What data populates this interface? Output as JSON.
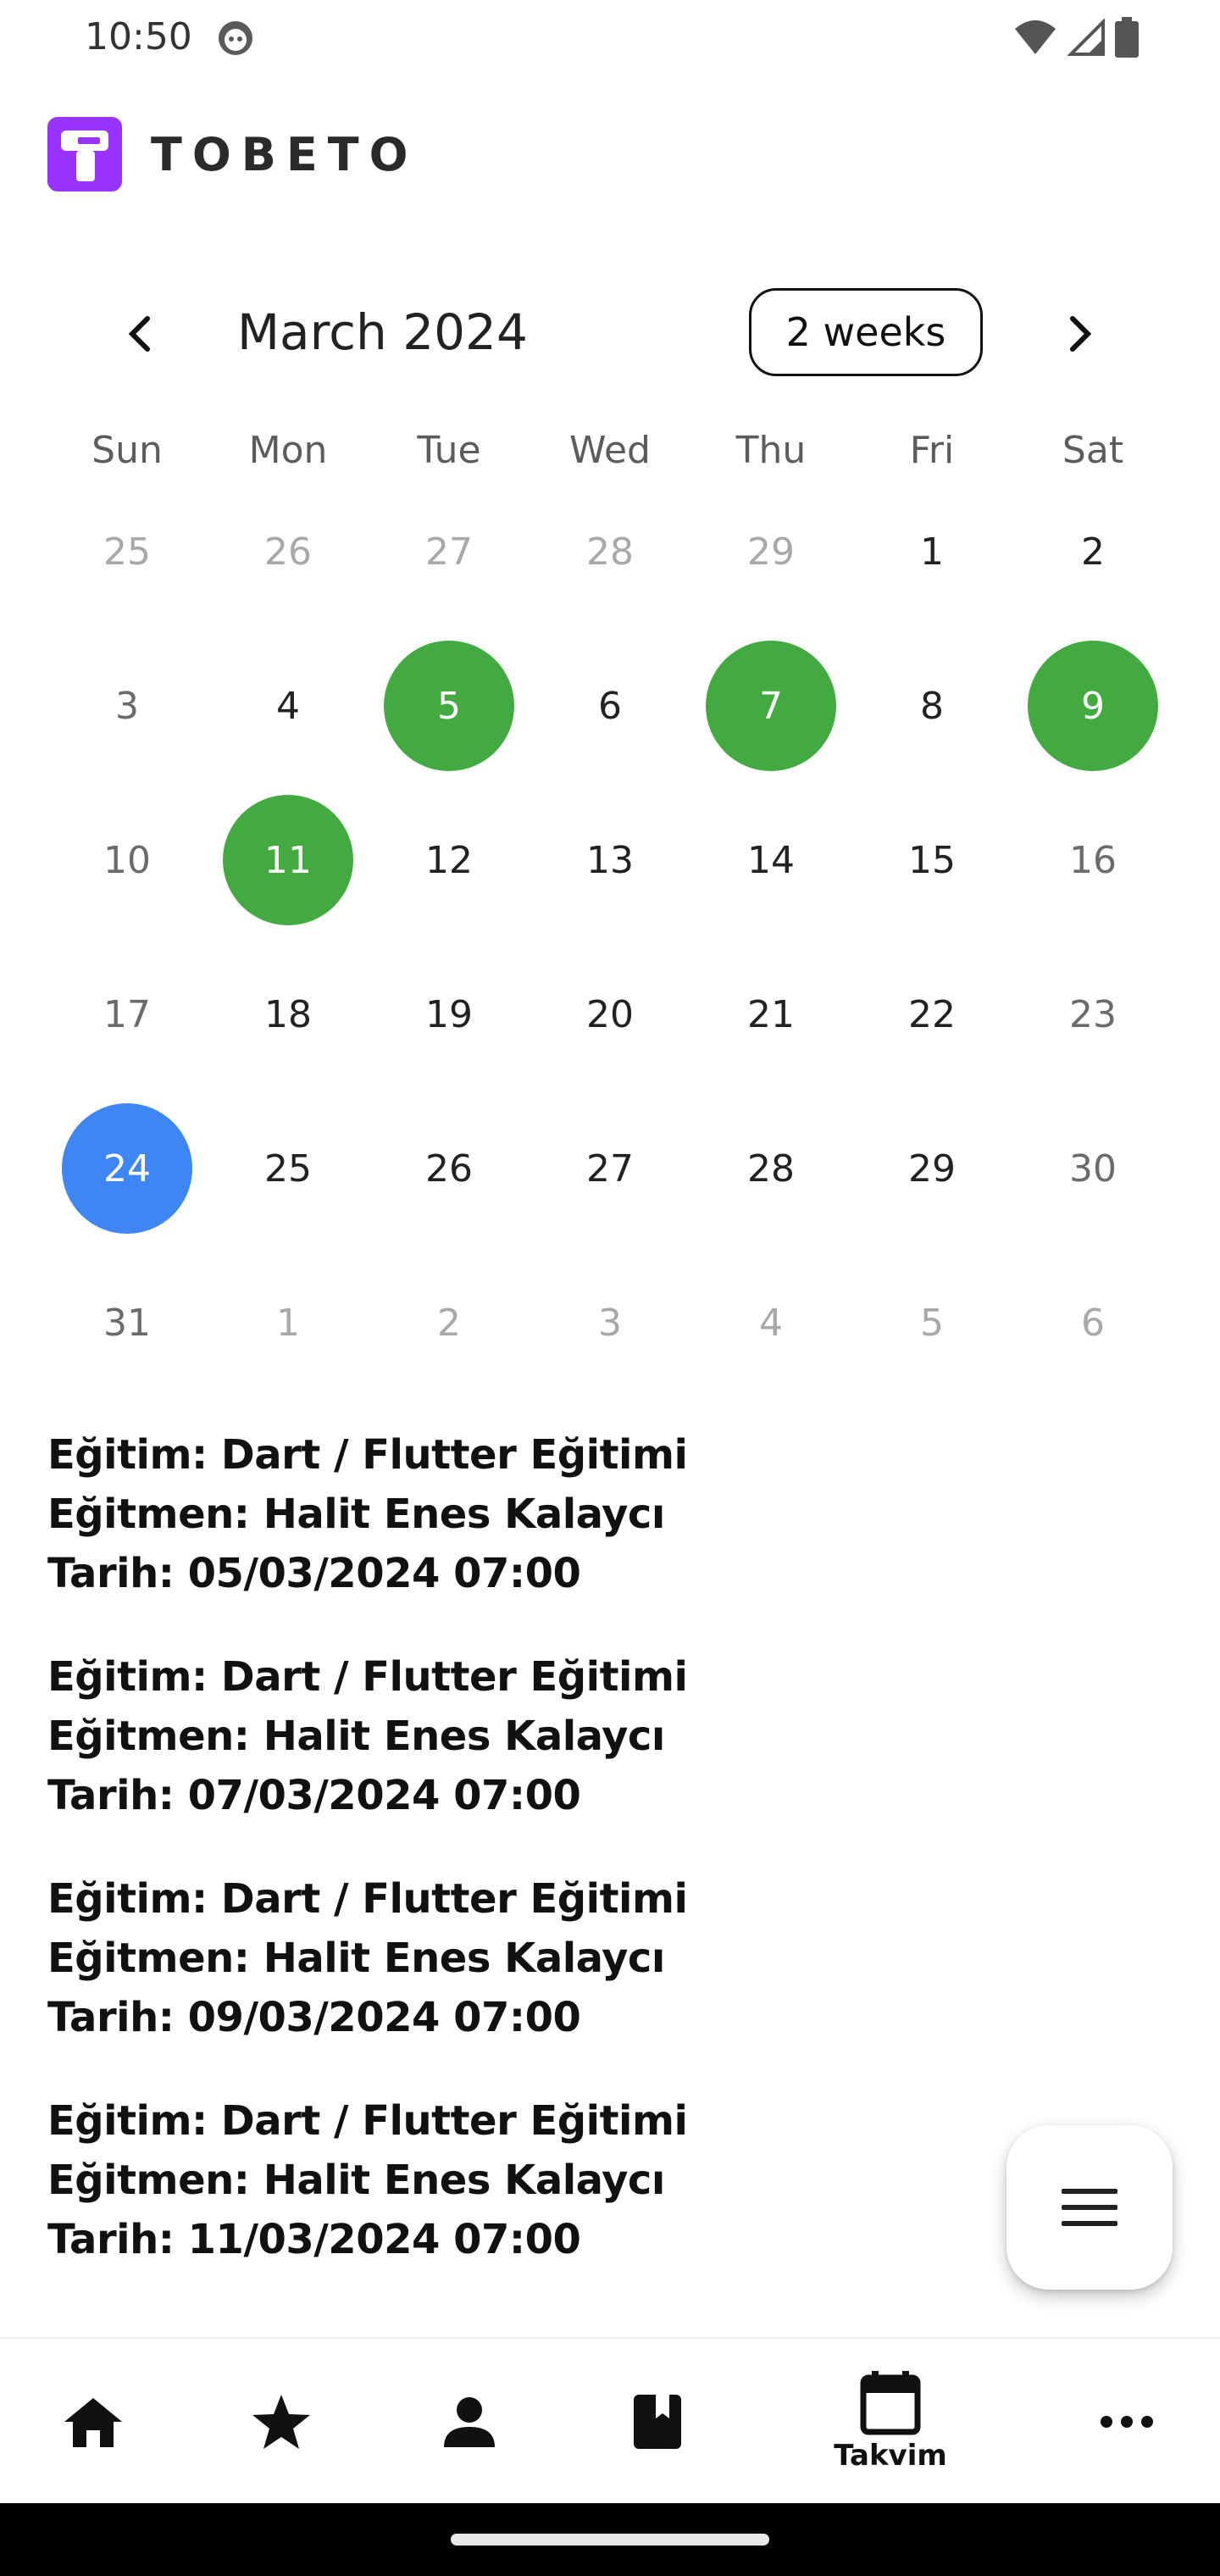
{
  "status_bar": {
    "time": "10:50"
  },
  "app": {
    "logo_text": "TOBETO",
    "brand_color": "#9933ff"
  },
  "calendar": {
    "month_title": "March 2024",
    "format_button": "2 weeks",
    "weekdays": [
      "Sun",
      "Mon",
      "Tue",
      "Wed",
      "Thu",
      "Fri",
      "Sat"
    ],
    "event_color": "#43a941",
    "today_color": "#3f86f5",
    "weeks": [
      [
        "25",
        "26",
        "27",
        "28",
        "29",
        "1",
        "2"
      ],
      [
        "3",
        "4",
        "5",
        "6",
        "7",
        "8",
        "9"
      ],
      [
        "10",
        "11",
        "12",
        "13",
        "14",
        "15",
        "16"
      ],
      [
        "17",
        "18",
        "19",
        "20",
        "21",
        "22",
        "23"
      ],
      [
        "24",
        "25",
        "26",
        "27",
        "28",
        "29",
        "30"
      ],
      [
        "31",
        "1",
        "2",
        "3",
        "4",
        "5",
        "6"
      ]
    ]
  },
  "events": [
    {
      "course": "Eğitim: Dart / Flutter Eğitimi",
      "teacher": "Eğitmen: Halit Enes Kalaycı",
      "date": "Tarih: 05/03/2024 07:00"
    },
    {
      "course": "Eğitim: Dart / Flutter Eğitimi",
      "teacher": "Eğitmen: Halit Enes Kalaycı",
      "date": "Tarih: 07/03/2024 07:00"
    },
    {
      "course": "Eğitim: Dart / Flutter Eğitimi",
      "teacher": "Eğitmen: Halit Enes Kalaycı",
      "date": "Tarih: 09/03/2024 07:00"
    },
    {
      "course": "Eğitim: Dart / Flutter Eğitimi",
      "teacher": "Eğitmen: Halit Enes Kalaycı",
      "date": "Tarih: 11/03/2024 07:00"
    }
  ],
  "bottom_nav": {
    "items": [
      {
        "icon": "home-icon"
      },
      {
        "icon": "star-icon"
      },
      {
        "icon": "person-icon"
      },
      {
        "icon": "book-icon"
      },
      {
        "icon": "calendar-icon",
        "label": "Takvim"
      },
      {
        "icon": "more-icon"
      }
    ]
  }
}
